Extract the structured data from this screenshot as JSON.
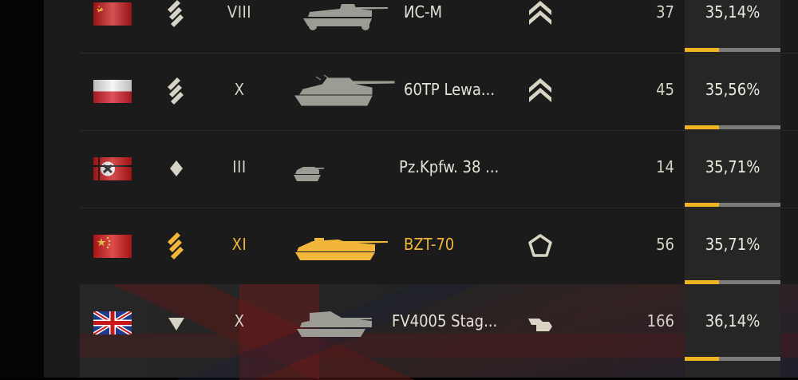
{
  "rows": [
    {
      "flag": "ussr",
      "class": "heavy",
      "tier": "VIII",
      "name": "ИС-М",
      "rank": "chevron",
      "battles": "37",
      "winrate": "35,14%",
      "progress": 0.36,
      "highlight": false
    },
    {
      "flag": "poland",
      "class": "heavy",
      "tier": "X",
      "name": "60TP Lewa...",
      "rank": "chevron",
      "battles": "45",
      "winrate": "35,56%",
      "progress": 0.36,
      "highlight": false
    },
    {
      "flag": "germany",
      "class": "light",
      "tier": "III",
      "name": "Pz.Kpfw. 38 ...",
      "rank": "",
      "battles": "14",
      "winrate": "35,71%",
      "progress": 0.36,
      "highlight": false
    },
    {
      "flag": "china",
      "class": "heavy",
      "tier": "XI",
      "name": "BZT-70",
      "rank": "pentagon",
      "battles": "56",
      "winrate": "35,71%",
      "progress": 0.36,
      "highlight": true
    },
    {
      "flag": "uk",
      "class": "td",
      "tier": "X",
      "name": "FV4005 Stag...",
      "rank": "flag",
      "battles": "166",
      "winrate": "36,14%",
      "progress": 0.36,
      "highlight": false
    }
  ],
  "colors": {
    "accent": "#f0b322",
    "text": "#d5d2c6",
    "gold": "#f2b63a"
  }
}
